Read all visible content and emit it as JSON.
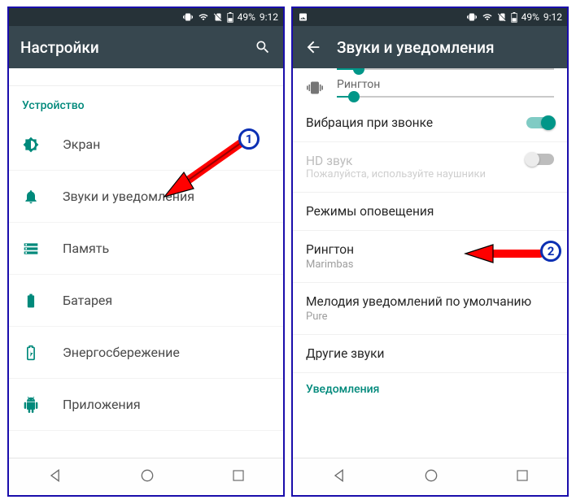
{
  "status": {
    "battery_pct": "49%",
    "clock": "9:12"
  },
  "left": {
    "title": "Настройки",
    "section": "Устройство",
    "rows": [
      {
        "label": "Экран"
      },
      {
        "label": "Звуки и уведомления"
      },
      {
        "label": "Память"
      },
      {
        "label": "Батарея"
      },
      {
        "label": "Энергосбережение"
      },
      {
        "label": "Приложения"
      }
    ]
  },
  "right": {
    "title": "Звуки и уведомления",
    "ringtone_label": "Рингтон",
    "vibrate": {
      "title": "Вибрация при звонке"
    },
    "hd_sound": {
      "title": "HD звук",
      "subtitle": "Пожалуйста, используйте наушники"
    },
    "alert_modes": "Режимы оповещения",
    "ringtone_pref": {
      "title": "Рингтон",
      "subtitle": "Marimbas"
    },
    "notif_default": {
      "title": "Мелодия уведомлений по умолчанию",
      "subtitle": "Pure"
    },
    "other_sounds": "Другие звуки",
    "notifications_section": "Уведомления"
  },
  "badges": {
    "one": "1",
    "two": "2"
  }
}
